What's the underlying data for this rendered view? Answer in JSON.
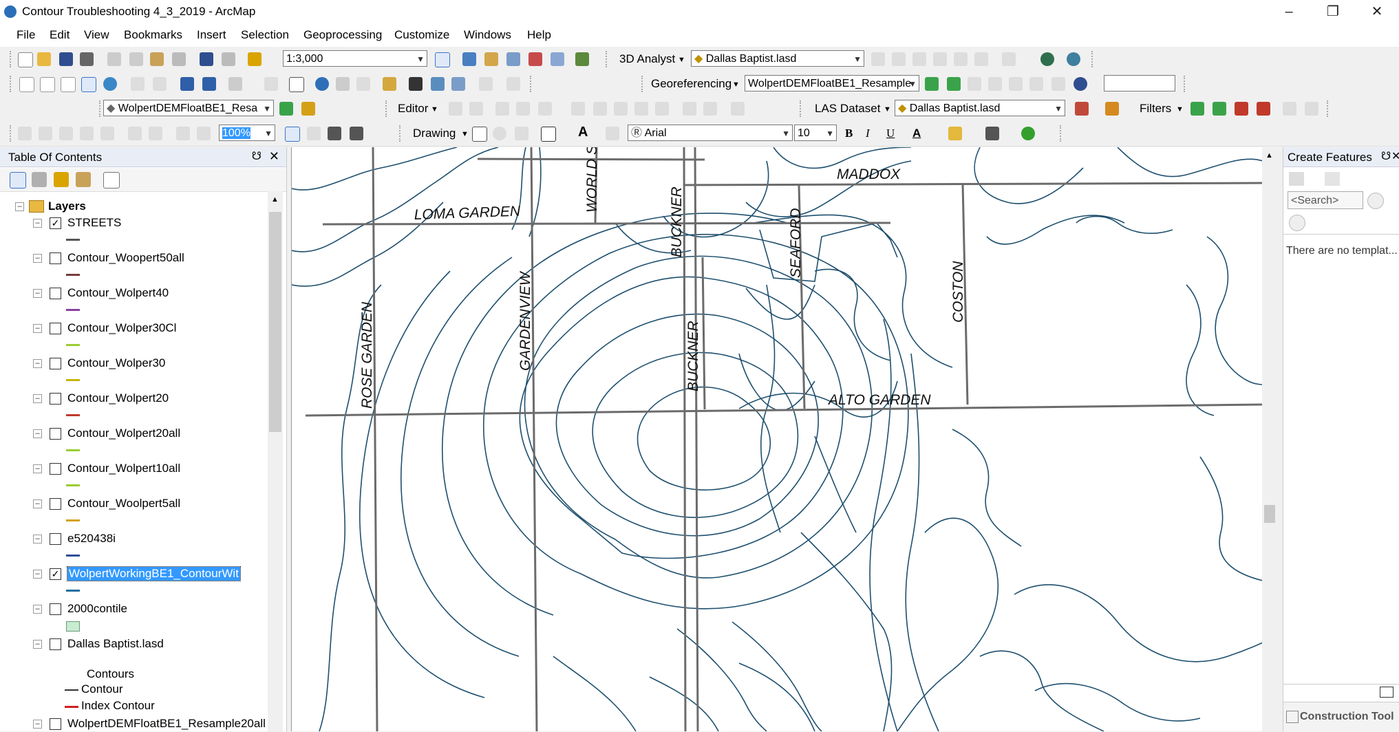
{
  "window": {
    "title": "Contour Troubleshooting 4_3_2019 - ArcMap"
  },
  "menu": [
    "File",
    "Edit",
    "View",
    "Bookmarks",
    "Insert",
    "Selection",
    "Geoprocessing",
    "Customize",
    "Windows",
    "Help"
  ],
  "toolbars": {
    "scale": "1:3,000",
    "analyst3d": "3D Analyst",
    "las_layer_1": "Dallas Baptist.lasd",
    "georeferencing": "Georeferencing",
    "georef_layer": "WolpertDEMFloatBE1_Resample",
    "raster_layer": "WolpertDEMFloatBE1_Resa",
    "editor": "Editor",
    "las_dataset": "LAS Dataset",
    "las_layer_2": "Dallas Baptist.lasd",
    "filters": "Filters",
    "zoom_pct": "100%",
    "drawing": "Drawing",
    "font_name": "Arial",
    "font_size": "10",
    "bold": "B",
    "italic": "I",
    "underline": "U"
  },
  "toc": {
    "title": "Table Of Contents",
    "root": "Layers",
    "layers": [
      {
        "name": "STREETS",
        "checked": true,
        "symbol_color": "#555555"
      },
      {
        "name": "Contour_Woopert50all",
        "checked": false,
        "symbol_color": "#7a3b3b"
      },
      {
        "name": "Contour_Wolpert40",
        "checked": false,
        "symbol_color": "#8a3fa0"
      },
      {
        "name": "Contour_Wolper30Cl",
        "checked": false,
        "symbol_color": "#9acd32"
      },
      {
        "name": "Contour_Wolper30",
        "checked": false,
        "symbol_color": "#c8b400"
      },
      {
        "name": "Contour_Wolpert20",
        "checked": false,
        "symbol_color": "#c0392b"
      },
      {
        "name": "Contour_Wolpert20all",
        "checked": false,
        "symbol_color": "#9acd32"
      },
      {
        "name": "Contour_Wolpert10all",
        "checked": false,
        "symbol_color": "#9acd32"
      },
      {
        "name": "Contour_Woolpert5all",
        "checked": false,
        "symbol_color": "#d4a017"
      },
      {
        "name": "e520438i",
        "checked": false,
        "symbol_color": "#2e4d9a"
      },
      {
        "name": "WolpertWorkingBE1_ContourWit",
        "checked": true,
        "symbol_color": "#1f6f9f",
        "selected": true
      },
      {
        "name": "2000contile",
        "checked": false,
        "symbol_color": "#c8ecd0"
      },
      {
        "name": "Dallas Baptist.lasd",
        "checked": false,
        "symbol_color": ""
      },
      {
        "name": "WolpertDEMFloatBE1_Resample20all",
        "checked": false,
        "symbol_color": ""
      }
    ],
    "legend": {
      "heading": "Contours",
      "contour": "Contour",
      "index_contour": "Index Contour"
    }
  },
  "map": {
    "contour_color": "#1e4f6e",
    "street_color": "#6b6b6b",
    "streets": [
      "LOMA GARDEN",
      "WORLD STORE",
      "MADDOX",
      "BUCKNER",
      "SEAFORD",
      "COSTON",
      "ROSE GARDEN",
      "GARDENVIEW",
      "BUCKNER",
      "ALTO GARDEN"
    ]
  },
  "create_features": {
    "title": "Create Features",
    "search_placeholder": "<Search>",
    "message": "There are no templat...",
    "construction_tools": "Construction Tool"
  }
}
